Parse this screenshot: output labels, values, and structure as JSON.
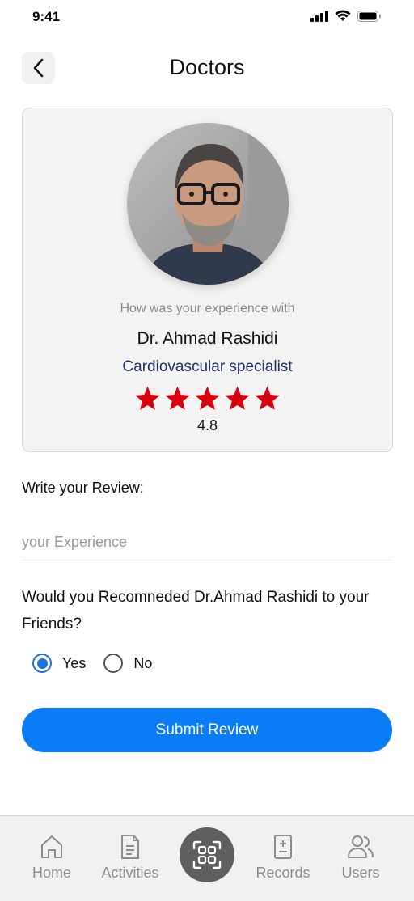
{
  "status_bar": {
    "time": "9:41",
    "icons": [
      "signal-icon",
      "wifi-icon",
      "battery-icon"
    ]
  },
  "header": {
    "title": "Doctors",
    "back_icon": "chevron-left-icon"
  },
  "doctor": {
    "experience_prompt": "How was your experience with",
    "name": "Dr. Ahmad Rashidi",
    "specialty": "Cardiovascular specialist",
    "rating": "4.8",
    "stars_filled": 5,
    "stars_total": 5
  },
  "review": {
    "label": "Write your Review:",
    "placeholder": "your Experience",
    "value": ""
  },
  "recommend": {
    "question": "Would you Recomneded Dr.Ahmad Rashidi to your Friends?",
    "options": [
      {
        "label": "Yes",
        "selected": true
      },
      {
        "label": "No",
        "selected": false
      }
    ]
  },
  "submit": {
    "label": "Submit Review"
  },
  "bottom_nav": {
    "items": [
      {
        "label": "Home",
        "icon": "home-icon"
      },
      {
        "label": "Activities",
        "icon": "document-icon"
      },
      {
        "label": "",
        "icon": "qr-scan-icon"
      },
      {
        "label": "Records",
        "icon": "medical-record-icon"
      },
      {
        "label": "Users",
        "icon": "users-icon"
      }
    ]
  },
  "colors": {
    "accent": "#0a7cf6",
    "star": "#d6000f",
    "specialty": "#1f2f6b",
    "radio_selected": "#1e6fe0",
    "card_bg": "#f3f3f4",
    "nav_bg": "#f1f1f2"
  }
}
